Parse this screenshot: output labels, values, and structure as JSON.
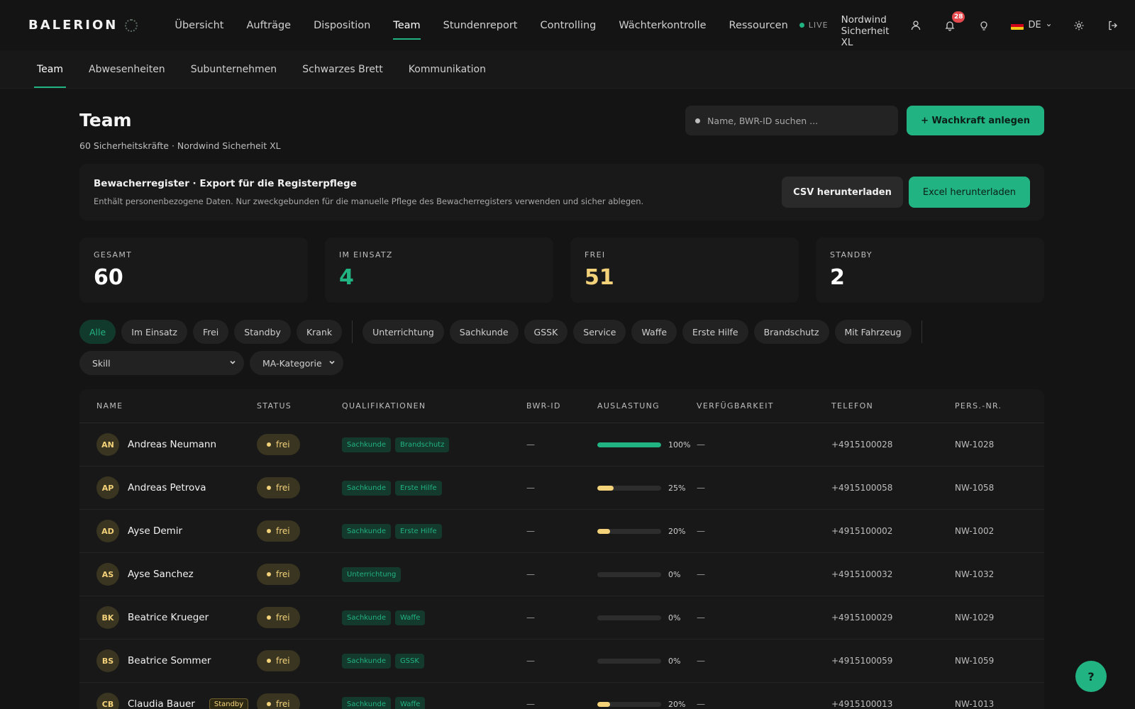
{
  "app": {
    "logo": "BALERION",
    "live": "LIVE",
    "tenant": "Nordwind Sicherheit XL",
    "notifications": "28",
    "language": "DE"
  },
  "nav": [
    {
      "label": "Übersicht",
      "active": false
    },
    {
      "label": "Aufträge",
      "active": false
    },
    {
      "label": "Disposition",
      "active": false
    },
    {
      "label": "Team",
      "active": true
    },
    {
      "label": "Stundenreport",
      "active": false
    },
    {
      "label": "Controlling",
      "active": false
    },
    {
      "label": "Wächterkontrolle",
      "active": false
    },
    {
      "label": "Ressourcen",
      "active": false
    }
  ],
  "subnav": [
    {
      "label": "Team",
      "active": true
    },
    {
      "label": "Abwesenheiten",
      "active": false
    },
    {
      "label": "Subunternehmen",
      "active": false
    },
    {
      "label": "Schwarzes Brett",
      "active": false
    },
    {
      "label": "Kommunikation",
      "active": false
    }
  ],
  "page": {
    "title": "Team",
    "subtitle": "60 Sicherheitskräfte · Nordwind Sicherheit XL",
    "search_placeholder": "Name, BWR-ID suchen ...",
    "add_button": "+ Wachkraft anlegen"
  },
  "export": {
    "title": "Bewacherregister · Export für die Registerpflege",
    "description": "Enthält personenbezogene Daten. Nur zweckgebunden für die manuelle Pflege des Bewacherregisters verwenden und sicher ablegen.",
    "csv_button": "CSV herunterladen",
    "excel_button": "Excel herunterladen"
  },
  "stats": [
    {
      "label": "GESAMT",
      "value": "60",
      "color": "#ffffff"
    },
    {
      "label": "IM EINSATZ",
      "value": "4",
      "color": "#22b383"
    },
    {
      "label": "FREI",
      "value": "51",
      "color": "#f4d27a"
    },
    {
      "label": "STANDBY",
      "value": "2",
      "color": "#ffffff"
    }
  ],
  "filters": {
    "status": [
      "Alle",
      "Im Einsatz",
      "Frei",
      "Standby",
      "Krank"
    ],
    "qualifications": [
      "Unterrichtung",
      "Sachkunde",
      "GSSK",
      "Service",
      "Waffe",
      "Erste Hilfe",
      "Brandschutz",
      "Mit Fahrzeug"
    ],
    "skill_select": "Skill",
    "category_select": "MA-Kategorie"
  },
  "table": {
    "columns": [
      "NAME",
      "STATUS",
      "QUALIFIKATIONEN",
      "BWR-ID",
      "AUSLASTUNG",
      "VERFÜGBARKEIT",
      "TELEFON",
      "PERS.-NR."
    ],
    "rows": [
      {
        "initials": "AN",
        "name": "Andreas Neumann",
        "tag": "",
        "status": "frei",
        "quals": [
          "Sachkunde",
          "Brandschutz"
        ],
        "bwr": "—",
        "load": 100,
        "load_label": "100%",
        "availability": "—",
        "phone": "+4915100028",
        "pers": "NW-1028"
      },
      {
        "initials": "AP",
        "name": "Andreas Petrova",
        "tag": "",
        "status": "frei",
        "quals": [
          "Sachkunde",
          "Erste Hilfe"
        ],
        "bwr": "—",
        "load": 25,
        "load_label": "25%",
        "availability": "—",
        "phone": "+4915100058",
        "pers": "NW-1058"
      },
      {
        "initials": "AD",
        "name": "Ayse Demir",
        "tag": "",
        "status": "frei",
        "quals": [
          "Sachkunde",
          "Erste Hilfe"
        ],
        "bwr": "—",
        "load": 20,
        "load_label": "20%",
        "availability": "—",
        "phone": "+4915100002",
        "pers": "NW-1002"
      },
      {
        "initials": "AS",
        "name": "Ayse Sanchez",
        "tag": "",
        "status": "frei",
        "quals": [
          "Unterrichtung"
        ],
        "bwr": "—",
        "load": 0,
        "load_label": "0%",
        "availability": "—",
        "phone": "+4915100032",
        "pers": "NW-1032"
      },
      {
        "initials": "BK",
        "name": "Beatrice Krueger",
        "tag": "",
        "status": "frei",
        "quals": [
          "Sachkunde",
          "Waffe"
        ],
        "bwr": "—",
        "load": 0,
        "load_label": "0%",
        "availability": "—",
        "phone": "+4915100029",
        "pers": "NW-1029"
      },
      {
        "initials": "BS",
        "name": "Beatrice Sommer",
        "tag": "",
        "status": "frei",
        "quals": [
          "Sachkunde",
          "GSSK"
        ],
        "bwr": "—",
        "load": 0,
        "load_label": "0%",
        "availability": "—",
        "phone": "+4915100059",
        "pers": "NW-1059"
      },
      {
        "initials": "CB",
        "name": "Claudia Bauer",
        "tag": "Standby",
        "status": "frei",
        "quals": [
          "Sachkunde",
          "Waffe"
        ],
        "bwr": "—",
        "load": 20,
        "load_label": "20%",
        "availability": "—",
        "phone": "+4915100013",
        "pers": "NW-1013"
      }
    ]
  },
  "colors": {
    "accent": "#22b383",
    "warning": "#f4d27a",
    "badge": "#e5484d"
  },
  "help_label": "?"
}
